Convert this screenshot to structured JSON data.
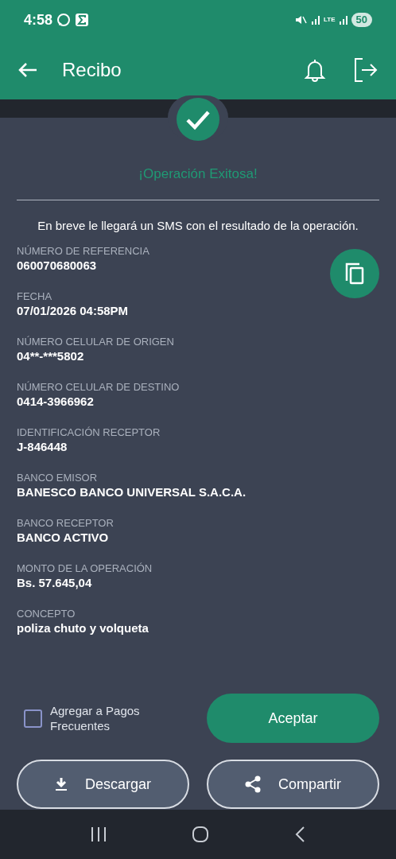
{
  "status_bar": {
    "time": "4:58",
    "network": "LTE",
    "battery": "50"
  },
  "app_bar": {
    "title": "Recibo"
  },
  "result": {
    "title": "¡Operación Exitosa!",
    "message": "En breve le llegará un SMS con el resultado de la operación."
  },
  "fields": [
    {
      "label": "NÚMERO DE REFERENCIA",
      "value": "060070680063"
    },
    {
      "label": "FECHA",
      "value": "07/01/2026 04:58PM"
    },
    {
      "label": "NÚMERO CELULAR DE ORIGEN",
      "value": "04**-***5802"
    },
    {
      "label": "NÚMERO CELULAR DE DESTINO",
      "value": "0414-3966962"
    },
    {
      "label": "IDENTIFICACIÓN RECEPTOR",
      "value": "J-846448"
    },
    {
      "label": "BANCO EMISOR",
      "value": "BANESCO BANCO UNIVERSAL S.A.C.A."
    },
    {
      "label": "BANCO RECEPTOR",
      "value": "BANCO ACTIVO"
    },
    {
      "label": "MONTO DE LA OPERACIÓN",
      "value": "Bs. 57.645,04"
    },
    {
      "label": "CONCEPTO",
      "value": "poliza chuto y volqueta"
    }
  ],
  "frequent_checkbox": {
    "label": "Agregar a Pagos Frecuentes",
    "checked": false
  },
  "buttons": [
    {
      "kind": "accept",
      "label": "Aceptar"
    },
    {
      "kind": "download",
      "label": "Descargar"
    },
    {
      "kind": "share",
      "label": "Compartir"
    }
  ]
}
